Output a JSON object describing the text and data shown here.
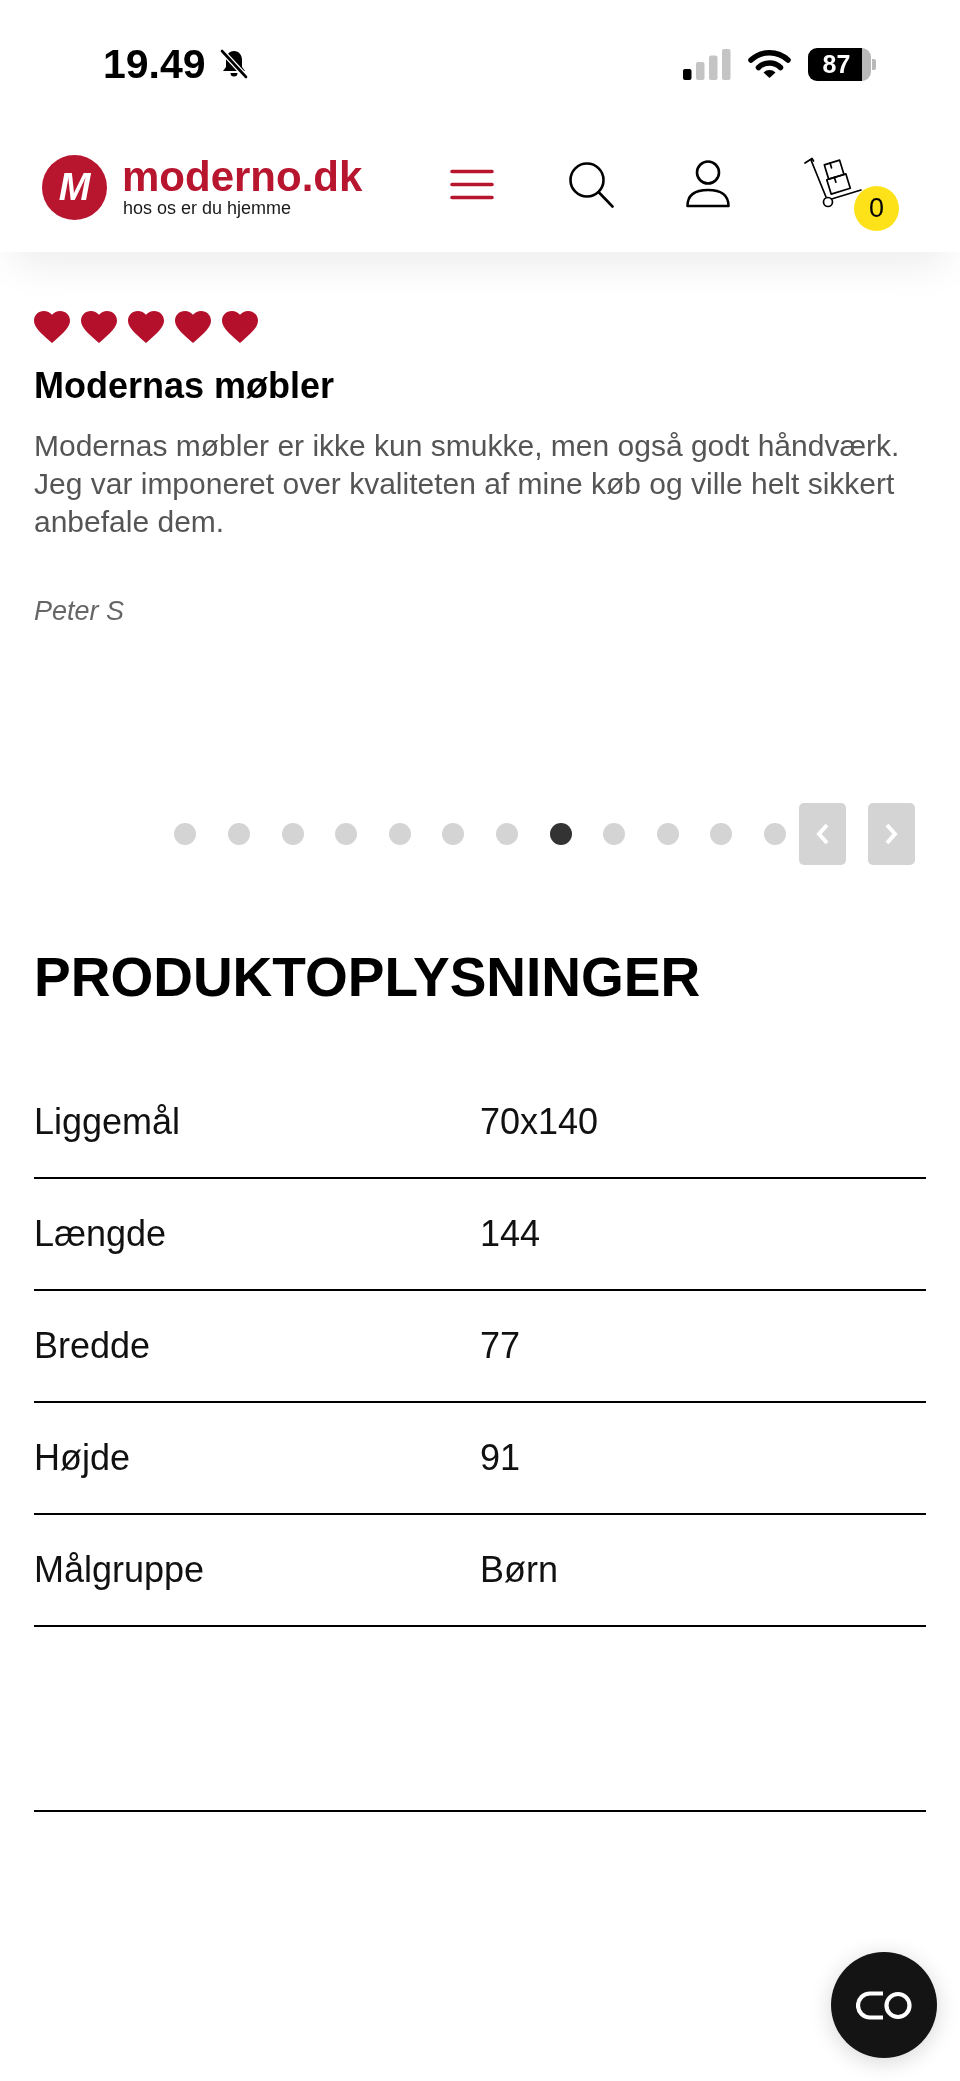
{
  "status_bar": {
    "time": "19.49",
    "battery": "87"
  },
  "header": {
    "logo": {
      "mark": "M",
      "wordmark": "moderno.dk",
      "tagline": "hos os er du hjemme"
    },
    "cart_count": "0"
  },
  "review": {
    "stars": 5,
    "title": "Modernas møbler",
    "text": "Modernas møbler er ikke kun smukke, men også godt håndværk. Jeg var imponeret over kvaliteten af mine køb og ville helt sikkert anbefale dem.",
    "author": "Peter S"
  },
  "carousel": {
    "dots": [
      {
        "selected": false
      },
      {
        "selected": false
      },
      {
        "selected": false
      },
      {
        "selected": false
      },
      {
        "selected": false
      },
      {
        "selected": false
      },
      {
        "selected": false
      },
      {
        "selected": true
      },
      {
        "selected": false
      },
      {
        "selected": false
      },
      {
        "selected": false
      },
      {
        "selected": false
      }
    ]
  },
  "product_info": {
    "title": "PRODUKTOPLYSNINGER",
    "rows": [
      {
        "label": "Liggemål",
        "value": "70x140"
      },
      {
        "label": "Længde",
        "value": "144"
      },
      {
        "label": "Bredde",
        "value": "77"
      },
      {
        "label": "Højde",
        "value": "91"
      },
      {
        "label": "Målgruppe",
        "value": "Børn"
      }
    ]
  }
}
